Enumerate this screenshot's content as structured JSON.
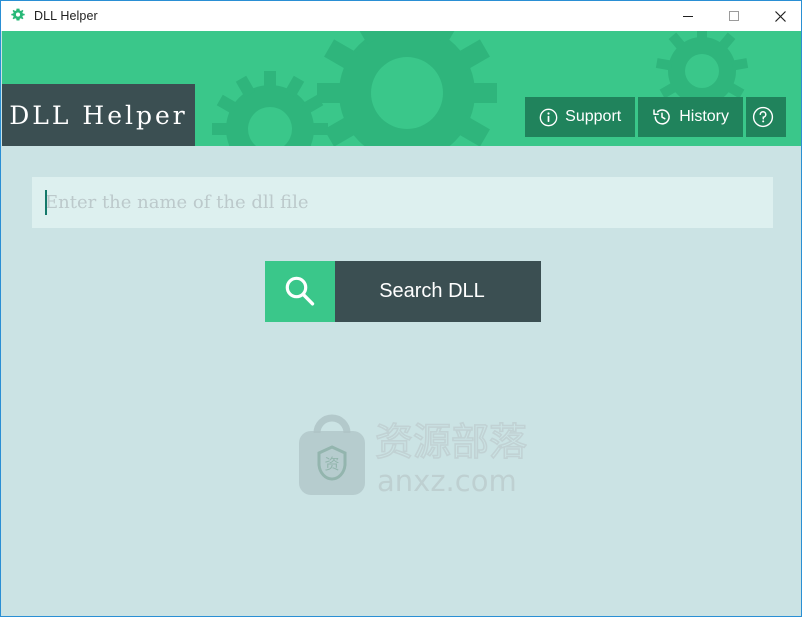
{
  "window": {
    "title": "DLL Helper",
    "app_icon": "gear-icon",
    "controls": {
      "minimize": "minimize-icon",
      "maximize": "maximize-icon",
      "close": "close-icon"
    },
    "border_color": "#2a8fd4"
  },
  "header": {
    "background_color": "#3ac78a",
    "gear_decoration_color": "#2fb57c",
    "logo": {
      "text": "DLL Helper",
      "plate_color": "#3b4f52",
      "text_color": "#ffffff"
    },
    "buttons": [
      {
        "label": "Support",
        "icon": "info-circle-icon",
        "background_color": "#20835c"
      },
      {
        "label": "History",
        "icon": "history-clock-icon",
        "background_color": "#20835c"
      },
      {
        "label": "",
        "icon": "question-circle-icon",
        "background_color": "#20835c"
      }
    ]
  },
  "main": {
    "background_color": "#cbe3e4",
    "search_field": {
      "placeholder": "Enter the name of the dll file",
      "value": "",
      "background_color": "#ddf0ef",
      "caret_visible": true
    },
    "search_button": {
      "label": "Search DLL",
      "icon": "magnifier-icon",
      "icon_zone_color": "#3ac78a",
      "text_zone_color": "#3b4f52"
    }
  },
  "watermark": {
    "site": "anxz.com",
    "text_cn": "资源部落",
    "logo_icon": "shield-bag-icon",
    "color": "#a8b8bb"
  }
}
